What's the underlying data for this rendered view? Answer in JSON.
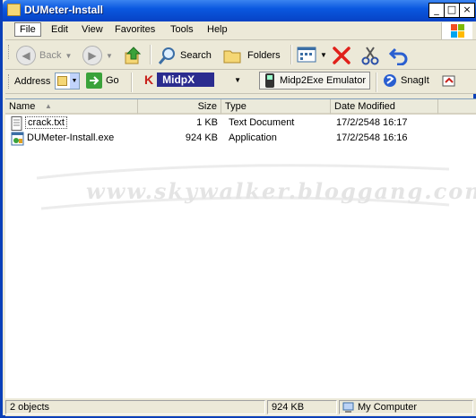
{
  "window": {
    "title": "DUMeter-Install",
    "controls": {
      "minimize": "_",
      "maximize": "□",
      "close": "×"
    }
  },
  "menu": {
    "items": [
      "File",
      "Edit",
      "View",
      "Favorites",
      "Tools",
      "Help"
    ]
  },
  "toolbar": {
    "back_label": "Back",
    "search_label": "Search",
    "folders_label": "Folders"
  },
  "address_bar": {
    "label": "Address",
    "go_label": "Go",
    "midp_label": "MidpX",
    "emulator_label": "Midp2Exe Emulator",
    "snagit_label": "SnagIt"
  },
  "columns": {
    "name": "Name",
    "size": "Size",
    "type": "Type",
    "date_modified": "Date Modified"
  },
  "files": [
    {
      "name": "crack.txt",
      "size": "1 KB",
      "type": "Text Document",
      "date": "17/2/2548 16:17",
      "icon": "text-file-icon"
    },
    {
      "name": "DUMeter-Install.exe",
      "size": "924 KB",
      "type": "Application",
      "date": "17/2/2548 16:16",
      "icon": "exe-file-icon"
    }
  ],
  "watermark": "www.skywalker.bloggang.com",
  "status": {
    "objects": "2 objects",
    "size": "924 KB",
    "location": "My Computer"
  },
  "colors": {
    "titlebar": "#0a58e0",
    "chrome": "#ece9d8",
    "close_red": "#e0201a",
    "folder_yellow": "#f5d775"
  }
}
